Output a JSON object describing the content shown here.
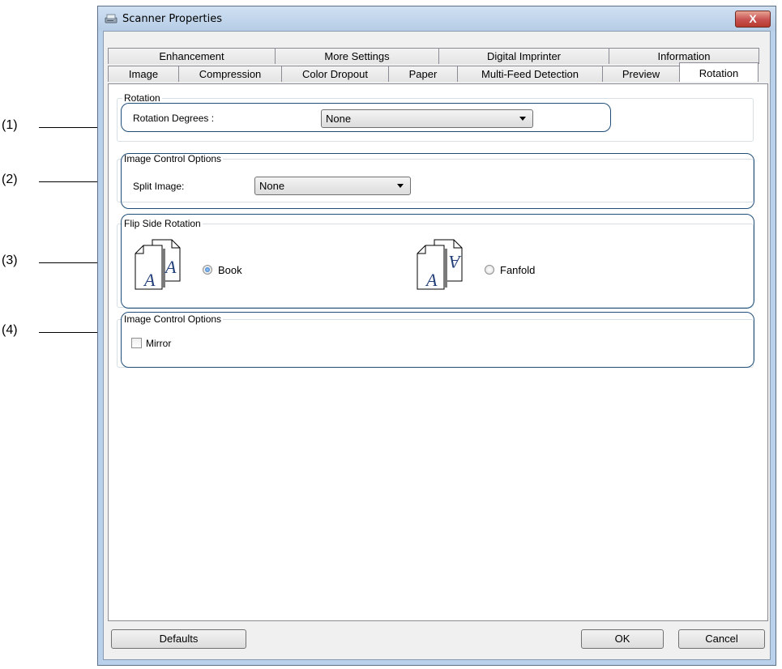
{
  "callouts": [
    "(1)",
    "(2)",
    "(3)",
    "(4)"
  ],
  "window": {
    "title": "Scanner Properties",
    "close_label": "X"
  },
  "tabs": {
    "row1": [
      "Enhancement",
      "More Settings",
      "Digital Imprinter",
      "Information"
    ],
    "row2": [
      "Image",
      "Compression",
      "Color Dropout",
      "Paper",
      "Multi-Feed Detection",
      "Preview",
      "Rotation"
    ],
    "active": "Rotation"
  },
  "rotation_group": {
    "title": "Rotation",
    "degrees_label": "Rotation Degrees :",
    "degrees_value": "None"
  },
  "split_group": {
    "title": "Image Control Options",
    "split_label": "Split Image:",
    "split_value": "None"
  },
  "flip_group": {
    "title": "Flip Side Rotation",
    "book_label": "Book",
    "fanfold_label": "Fanfold",
    "selected": "Book",
    "glyph": "A"
  },
  "mirror_group": {
    "title": "Image Control Options",
    "mirror_label": "Mirror",
    "mirror_checked": false
  },
  "buttons": {
    "defaults": "Defaults",
    "ok": "OK",
    "cancel": "Cancel"
  },
  "colors": {
    "highlight": "#1f4e79",
    "title_bg": "#b9d1ea",
    "close": "#c75050"
  }
}
